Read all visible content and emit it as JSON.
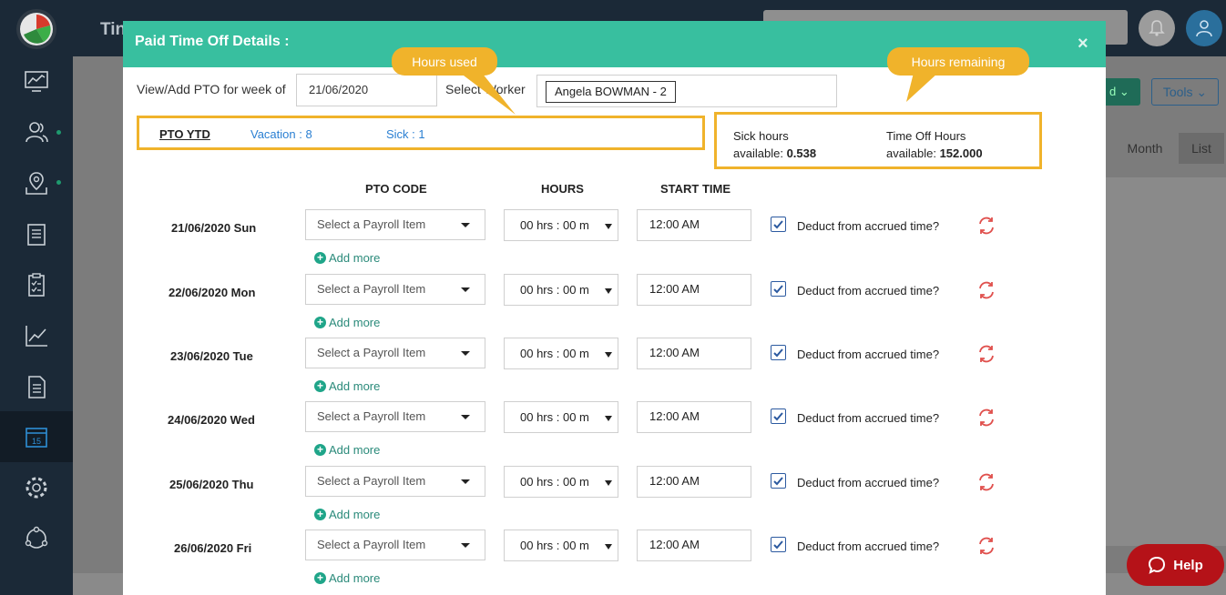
{
  "background": {
    "page_title": "Tin",
    "tools_label": "Tools",
    "month_label": "Month",
    "list_label": "List"
  },
  "modal": {
    "title": "Paid Time Off Details :",
    "close": "×",
    "week_label": "View/Add PTO for week of",
    "week_value": "21/06/2020",
    "worker_label": "Select Worker",
    "worker_value": "Angela BOWMAN - 2",
    "pto_ytd": {
      "label": "PTO YTD",
      "vacation": "Vacation : 8",
      "sick": "Sick : 1"
    },
    "remaining": {
      "sick_line1": "Sick hours",
      "sick_line2": "available:",
      "sick_value": "0.538",
      "timeoff_line1": "Time Off Hours",
      "timeoff_line2": "available:",
      "timeoff_value": "152.000"
    },
    "columns": {
      "pto_code": "PTO CODE",
      "hours": "HOURS",
      "start_time": "START TIME"
    },
    "rows": [
      {
        "date": "21/06/2020 Sun",
        "payroll": "Select a Payroll Item",
        "hours": "00 hrs : 00 m",
        "time": "12:00 AM",
        "deduct": "Deduct from accrued time?",
        "add_more": "Add more"
      },
      {
        "date": "22/06/2020 Mon",
        "payroll": "Select a Payroll Item",
        "hours": "00 hrs : 00 m",
        "time": "12:00 AM",
        "deduct": "Deduct from accrued time?",
        "add_more": "Add more"
      },
      {
        "date": "23/06/2020 Tue",
        "payroll": "Select a Payroll Item",
        "hours": "00 hrs : 00 m",
        "time": "12:00 AM",
        "deduct": "Deduct from accrued time?",
        "add_more": "Add more"
      },
      {
        "date": "24/06/2020 Wed",
        "payroll": "Select a Payroll Item",
        "hours": "00 hrs : 00 m",
        "time": "12:00 AM",
        "deduct": "Deduct from accrued time?",
        "add_more": "Add more"
      },
      {
        "date": "25/06/2020 Thu",
        "payroll": "Select a Payroll Item",
        "hours": "00 hrs : 00 m",
        "time": "12:00 AM",
        "deduct": "Deduct from accrued time?",
        "add_more": "Add more"
      },
      {
        "date": "26/06/2020 Fri",
        "payroll": "Select a Payroll Item",
        "hours": "00 hrs : 00 m",
        "time": "12:00 AM",
        "deduct": "Deduct from accrued time?",
        "add_more": "Add more"
      }
    ]
  },
  "callouts": {
    "hours_used": "Hours used",
    "hours_remaining": "Hours remaining"
  },
  "help": {
    "label": "Help"
  },
  "colors": {
    "modal_header": "#38bf9f",
    "callout": "#f0b32b",
    "link_blue": "#2a7fd2",
    "help_red": "#b51218",
    "sidebar": "#1b2937"
  }
}
